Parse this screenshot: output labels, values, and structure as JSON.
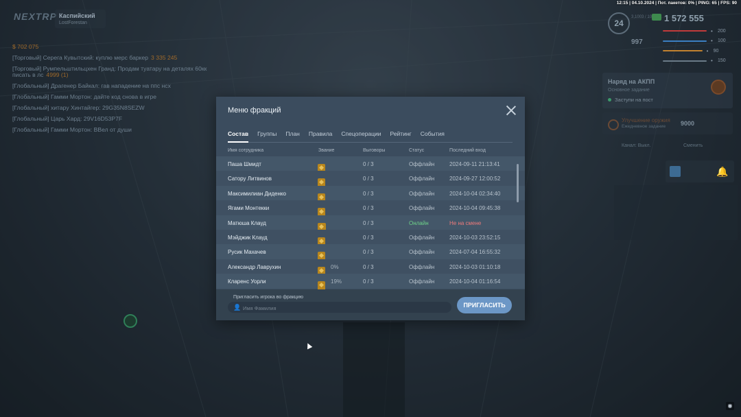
{
  "game": {
    "logo": "NEXTRP",
    "server_name": "Каспийский",
    "server_sub": "LostForestan"
  },
  "status_bar": "12:15 | 04.10.2024 | Пот. пакетов: 0% | PING: 65 | FPS: 90",
  "hud": {
    "level": "24",
    "level_progress": "3,1003 / 10000",
    "cash": "1 572 555",
    "balance2": "997",
    "bars": [
      {
        "value": "200",
        "color": "#c23b3b",
        "fill": 1.0
      },
      {
        "value": "100",
        "color": "#3b7fc2",
        "fill": 1.0
      },
      {
        "value": "90",
        "color": "#c2822f",
        "fill": 0.9
      },
      {
        "value": "150",
        "color": "#6b7b88",
        "fill": 1.0
      }
    ],
    "small_188": "188"
  },
  "task": {
    "title": "Наряд на АКПП",
    "subtitle": "Основное задание",
    "step": "Заступи на пост"
  },
  "task2": {
    "title": "Улучшение оружия",
    "subtitle": "Ежедневное задание",
    "amount": "9000"
  },
  "radio": {
    "label": "Канал: Выкл.",
    "switch": "Сменить"
  },
  "chat": [
    {
      "text": "$ 702 075",
      "money": ""
    },
    {
      "text": "[Торговый] Серега Кувытский: куплю мерс баркер",
      "money": "3 335 245"
    },
    {
      "text": "[Торговый] Румпельштильцхен Гранд: Продам туатару на деталях 60кк писать в лс",
      "money": "4999 (1)"
    },
    {
      "text": "[Глобальный] Драгенер Байкал: гав нападение на ппс нсх",
      "money": ""
    },
    {
      "text": "[Глобальный] Гамми Мортон: дайте код снова в игре",
      "money": ""
    },
    {
      "text": "[Глобальный] хитару Хинтайгер: 29G35N8SEZW",
      "money": ""
    },
    {
      "text": "[Глобальный] Царь Хард: 29V16D53P7F",
      "money": ""
    },
    {
      "text": "[Глобальный] Гамми Мортон: ВВел от души",
      "money": ""
    }
  ],
  "modal": {
    "title": "Меню фракций",
    "tabs": [
      "Состав",
      "Группы",
      "План",
      "Правила",
      "Спецоперации",
      "Рейтинг",
      "События"
    ],
    "columns": {
      "name": "Имя сотрудника",
      "rank": "Звание",
      "reprimands": "Выговоры",
      "status": "Статус",
      "last_login": "Последний вход"
    },
    "rows": [
      {
        "name": "Паша Шмидт",
        "pct": "",
        "rep": "0 / 3",
        "status": "Оффлайн",
        "last": "2024-09-11 21:13:41",
        "online": false,
        "badge": "single"
      },
      {
        "name": "Сатору Литвинов",
        "pct": "",
        "rep": "0 / 3",
        "status": "Оффлайн",
        "last": "2024-09-27 12:00:52",
        "online": false,
        "badge": "single"
      },
      {
        "name": "Максимилиан Диденко",
        "pct": "",
        "rep": "0 / 3",
        "status": "Оффлайн",
        "last": "2024-10-04 02:34:40",
        "online": false,
        "badge": "single"
      },
      {
        "name": "Ягами Монтекки",
        "pct": "",
        "rep": "0 / 3",
        "status": "Оффлайн",
        "last": "2024-10-04 09:45:38",
        "online": false,
        "badge": "single"
      },
      {
        "name": "Матюша Клауд",
        "pct": "",
        "rep": "0 / 3",
        "status": "Онлайн",
        "last": "Не на смене",
        "online": true,
        "badge": "double"
      },
      {
        "name": "Мэйджик Клауд",
        "pct": "",
        "rep": "0 / 3",
        "status": "Оффлайн",
        "last": "2024-10-03 23:52:15",
        "online": false,
        "badge": "single"
      },
      {
        "name": "Русик Махачев",
        "pct": "",
        "rep": "0 / 3",
        "status": "Оффлайн",
        "last": "2024-07-04 16:55:32",
        "online": false,
        "badge": "single"
      },
      {
        "name": "Александр Лаврухин",
        "pct": "0%",
        "rep": "0 / 3",
        "status": "Оффлайн",
        "last": "2024-10-03 01:10:18",
        "online": false,
        "badge": "tall"
      },
      {
        "name": "Кларенс Уорли",
        "pct": "19%",
        "rep": "0 / 3",
        "status": "Оффлайн",
        "last": "2024-10-04 01:16:54",
        "online": false,
        "badge": "tall"
      }
    ],
    "invite_label": "Пригласить игрока во фракцию",
    "invite_placeholder": "Имя Фамилия",
    "invite_button": "ПРИГЛАСИТЬ"
  }
}
